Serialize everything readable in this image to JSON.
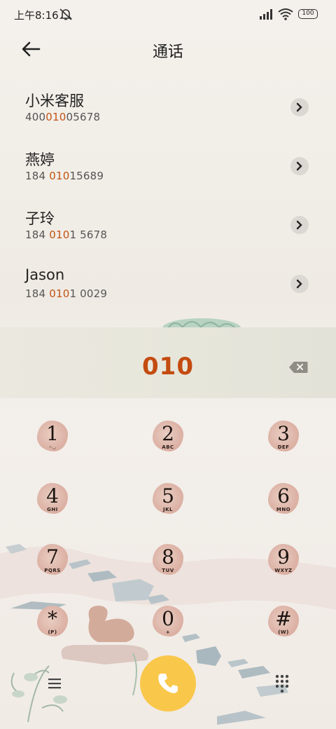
{
  "status_bar": {
    "time": "上午8:16",
    "battery": "100"
  },
  "header": {
    "title": "通话"
  },
  "contacts": [
    {
      "name": "小米客服",
      "number_pre": "400",
      "number_match": "010",
      "number_post": "05678"
    },
    {
      "name": "燕婷",
      "number_pre": "184 ",
      "number_match": "010",
      "number_post": "15689"
    },
    {
      "name": "子玲",
      "number_pre": "184 ",
      "number_match": "010",
      "number_post": "1 5678"
    },
    {
      "name": "Jason",
      "number_pre": "184 ",
      "number_match": "010",
      "number_post": "1 0029"
    }
  ],
  "dialer": {
    "number": "010"
  },
  "keypad": [
    {
      "digit": "1",
      "letters": "◦◡"
    },
    {
      "digit": "2",
      "letters": "ABC"
    },
    {
      "digit": "3",
      "letters": "DEF"
    },
    {
      "digit": "4",
      "letters": "GHI"
    },
    {
      "digit": "5",
      "letters": "JKL"
    },
    {
      "digit": "6",
      "letters": "MNO"
    },
    {
      "digit": "7",
      "letters": "PQRS"
    },
    {
      "digit": "8",
      "letters": "TUV"
    },
    {
      "digit": "9",
      "letters": "WXYZ"
    },
    {
      "digit": "*",
      "letters": "(P)"
    },
    {
      "digit": "0",
      "letters": "+"
    },
    {
      "digit": "#",
      "letters": "(W)"
    }
  ],
  "icons": {
    "back": "back-arrow-icon",
    "mute": "bell-off-icon",
    "signal": "signal-icon",
    "wifi": "wifi-icon",
    "chevron": "chevron-right-icon",
    "backspace": "backspace-icon",
    "menu": "menu-icon",
    "call": "phone-icon",
    "dialpad": "dialpad-icon"
  },
  "colors": {
    "accent": "#c44b10",
    "call_button": "#f9c74a",
    "key": "#dbafa2"
  }
}
